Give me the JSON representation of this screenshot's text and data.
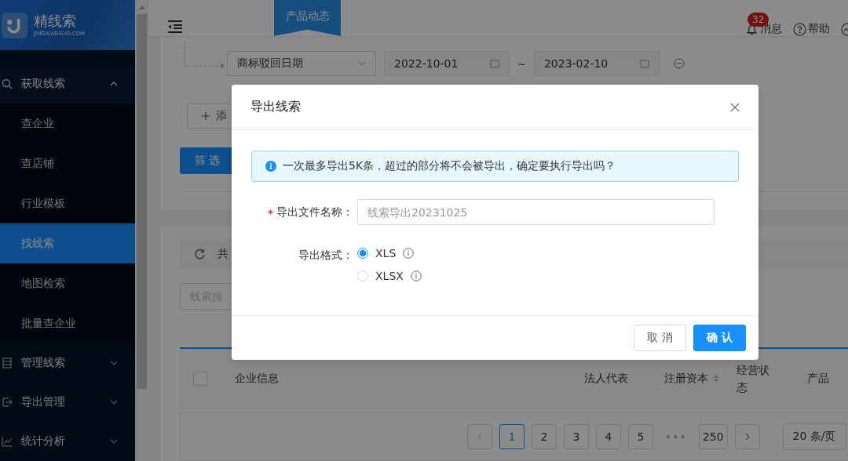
{
  "logo": {
    "name": "精线索",
    "domain": "JINGXIANSUO.COM"
  },
  "sidebar": {
    "items": [
      {
        "label": "获取线索",
        "expanded": true,
        "children": [
          {
            "label": "查企业",
            "selected": false
          },
          {
            "label": "查店铺",
            "selected": false
          },
          {
            "label": "行业模板",
            "selected": false
          },
          {
            "label": "找线索",
            "selected": true
          },
          {
            "label": "地图检索",
            "selected": false
          },
          {
            "label": "批量查企业",
            "selected": false
          }
        ]
      },
      {
        "label": "管理线索",
        "expanded": false
      },
      {
        "label": "导出管理",
        "expanded": false
      },
      {
        "label": "统计分析",
        "expanded": false
      }
    ]
  },
  "header": {
    "ribbon": "产品动态",
    "message_badge": "32",
    "messages": "消息",
    "help": "帮助"
  },
  "filter": {
    "field": "商标驳回日期",
    "date_from": "2022-10-01",
    "separator": "~",
    "date_to": "2023-02-10",
    "add_button": "添",
    "filter_button": "筛 选"
  },
  "results": {
    "toolbar_text": "共",
    "search_placeholder": "线索操",
    "table": {
      "select_all_checked": false,
      "columns": [
        "企业信息",
        "法人代表",
        "注册资本",
        "经营状态",
        "产品"
      ]
    },
    "pagination": {
      "pages": [
        {
          "label": "1",
          "selected": true
        },
        {
          "label": "2",
          "selected": false
        },
        {
          "label": "3",
          "selected": false
        },
        {
          "label": "4",
          "selected": false
        },
        {
          "label": "5",
          "selected": false
        },
        {
          "label": "•••",
          "kind": "ellipsis"
        },
        {
          "label": "250",
          "selected": false
        }
      ],
      "page_size": "20 条/页"
    }
  },
  "dialog": {
    "title": "导出线索",
    "alert": "一次最多导出5K条，超过的部分将不会被导出，确定要执行导出吗？",
    "fields": [
      {
        "label": "导出文件名称：",
        "required": true,
        "placeholder": "线索导出20231025"
      }
    ],
    "format_label": "导出格式：",
    "formats": [
      {
        "label": "XLS",
        "selected": true
      },
      {
        "label": "XLSX",
        "selected": false
      }
    ],
    "buttons": [
      {
        "label": "取 消",
        "kind": "default"
      },
      {
        "label": "确 认",
        "kind": "primary"
      }
    ]
  }
}
